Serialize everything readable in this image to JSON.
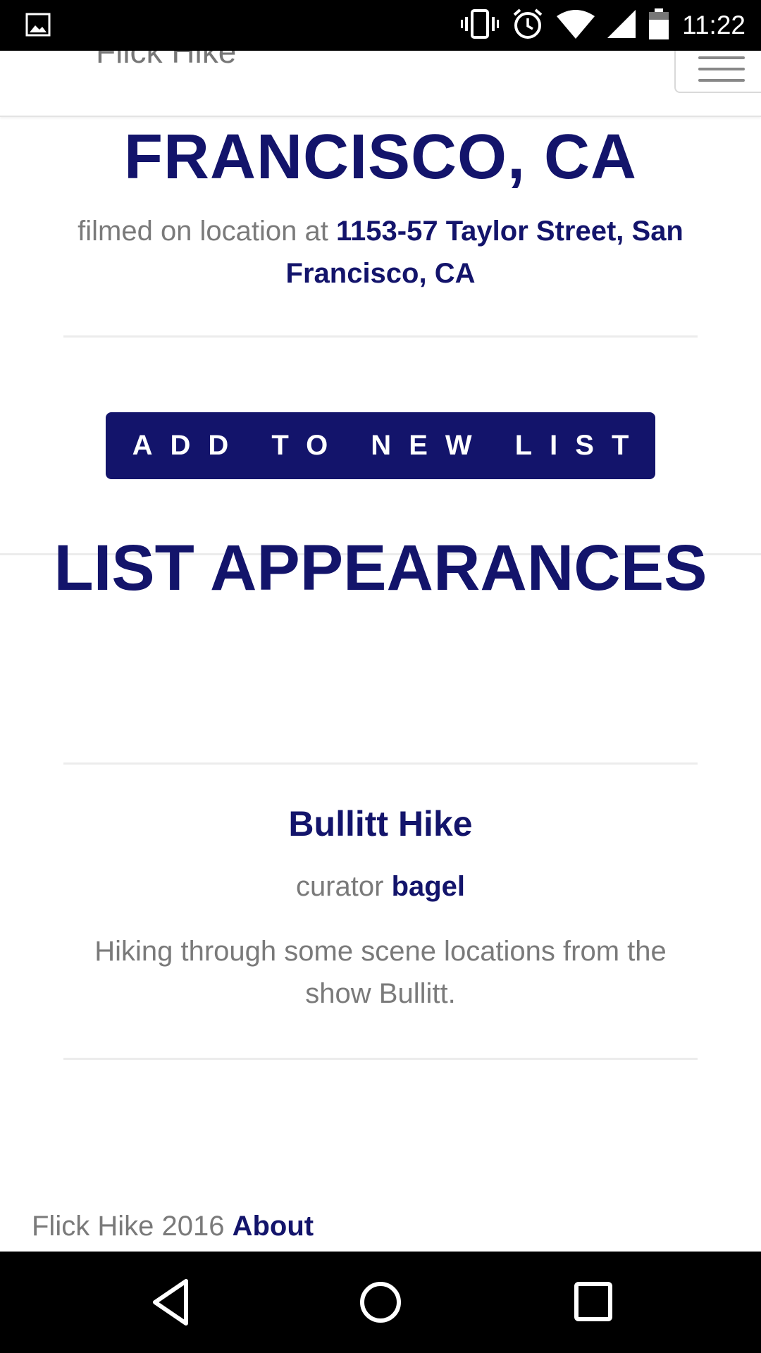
{
  "status_bar": {
    "time": "11:22",
    "icons": [
      "gallery-icon",
      "vibrate-icon",
      "alarm-icon",
      "wifi-icon",
      "signal-icon",
      "battery-icon"
    ]
  },
  "nav": {
    "brand": "Flick Hike",
    "menu_icon": "hamburger-menu-icon"
  },
  "location": {
    "title": "FRANCISCO, CA",
    "filmed_prefix": "filmed on location at",
    "address": "1153-57 Taylor Street, San Francisco, CA"
  },
  "add_button_label": "ADD TO NEW LIST",
  "list_appearances": {
    "heading": "LIST APPEARANCES",
    "items": [
      {
        "name": "Bullitt Hike",
        "curator_prefix": "curator",
        "curator": "bagel",
        "description": "Hiking through some scene locations from the show Bullitt."
      }
    ]
  },
  "footer": {
    "text": "Flick Hike 2016",
    "about_link": "About"
  },
  "system_nav": [
    "back-icon",
    "home-icon",
    "recents-icon"
  ],
  "colors": {
    "accent": "#13146b",
    "muted_text": "#7a7a7a"
  }
}
